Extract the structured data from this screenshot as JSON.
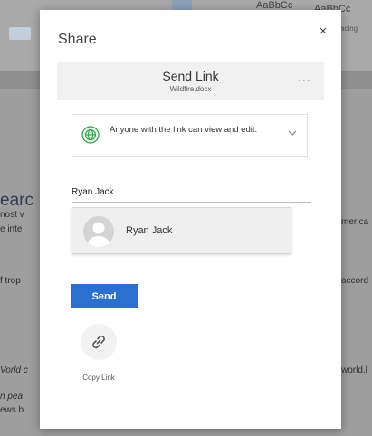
{
  "background": {
    "ribbon_styles": [
      "AaBbCc",
      "AaBbCc",
      "acing"
    ],
    "heading_fragment": "earc",
    "left_fragments": [
      "nost v",
      "e inte",
      "f trop",
      "Vorld c",
      "n pea",
      "ews.b"
    ],
    "right_fragments": [
      "merica",
      "accord",
      "world.l"
    ]
  },
  "dialog": {
    "title": "Share",
    "close_symbol": "×",
    "send_link": {
      "title": "Send Link",
      "file_name": "Wildfire.docx",
      "more_label": "..."
    },
    "permission": {
      "text": "Anyone with the link can view and edit.",
      "icon": "globe-icon"
    },
    "recipient": {
      "value": "Ryan Jack"
    },
    "suggestion": {
      "name": "Ryan Jack",
      "icon": "avatar"
    },
    "send_button_label": "Send",
    "copy_link_label": "Copy Link"
  },
  "colors": {
    "accent": "#2b6fd1",
    "globe": "#2e9e48"
  }
}
